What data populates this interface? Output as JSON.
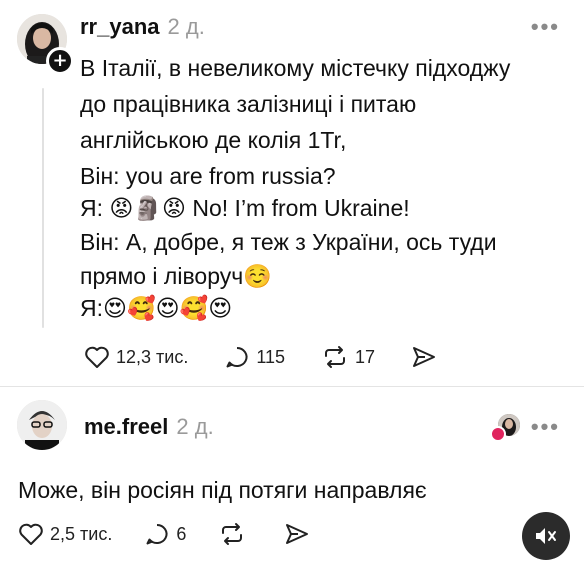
{
  "post1": {
    "username": "rr_yana",
    "time": "2 д.",
    "lines": [
      "В Італії, в невеликому містечку підходжу",
      "до працівника залізниці і питаю",
      "англійською де колія 1Tr,",
      "Він: you are from russia?",
      "Я: 😡🗿😡 No! I’m from Ukraine!",
      "Він: А, добре, я теж з України, ось туди",
      "прямо і ліворуч☺️",
      "Я:😍🥰😍🥰😍"
    ],
    "likes": "12,3 тис.",
    "comments": "115",
    "reposts": "17"
  },
  "post2": {
    "username": "me.freel",
    "time": "2 д.",
    "text": "Може, він росіян під потяги направляє",
    "likes": "2,5 тис.",
    "comments": "6"
  },
  "icons": {
    "more": "more-horizontal-icon",
    "like": "heart-outline-icon",
    "comment": "comment-bubble-icon",
    "repost": "repost-arrows-icon",
    "share": "send-icon",
    "mute": "speaker-muted-icon",
    "follow": "plus-icon"
  },
  "colors": {
    "text": "#111111",
    "secondary": "#9a9a9a",
    "divider": "#e4e4e4",
    "like_badge": "#e0245e"
  }
}
